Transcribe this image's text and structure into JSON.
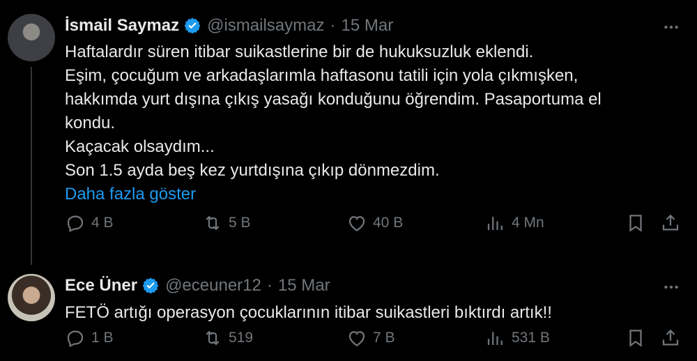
{
  "tweets": [
    {
      "author_name": "İsmail Saymaz",
      "handle": "@ismailsaymaz",
      "separator": "·",
      "date": "15 Mar",
      "lines": [
        "Haftalardır süren itibar suikastlerine bir de hukuksuzluk eklendi.",
        "Eşim, çocuğum ve arkadaşlarımla haftasonu tatili için yola çıkmışken,",
        "hakkımda yurt dışına çıkış yasağı konduğunu öğrendim. Pasaportuma el",
        "kondu.",
        "Kaçacak olsaydım...",
        "Son 1.5 ayda beş kez yurtdışına çıkıp dönmezdim."
      ],
      "show_more": "Daha fazla göster",
      "replies": "4 B",
      "retweets": "5 B",
      "likes": "40 B",
      "views": "4 Mn"
    },
    {
      "author_name": "Ece Üner",
      "handle": "@eceuner12",
      "separator": "·",
      "date": "15 Mar",
      "lines": [
        "FETÖ artığı operasyon çocuklarının itibar suikastleri bıktırdı artık!!"
      ],
      "replies": "1 B",
      "retweets": "519",
      "likes": "7 B",
      "views": "531 B"
    }
  ],
  "colors": {
    "background": "#000000",
    "text": "#e7e9ea",
    "muted": "#71767b",
    "link": "#1d9bf0",
    "verified": "#1d9bf0"
  },
  "icons": [
    "verified-badge-icon",
    "more-icon",
    "reply-icon",
    "retweet-icon",
    "like-icon",
    "views-icon",
    "bookmark-icon",
    "share-icon"
  ]
}
